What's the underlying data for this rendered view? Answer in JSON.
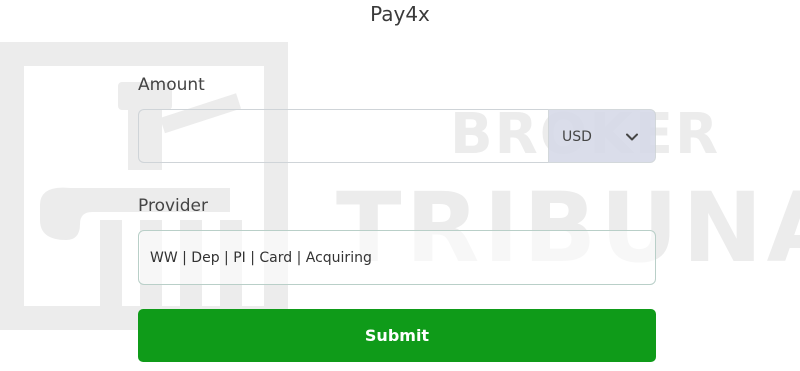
{
  "header": {
    "title": "Pay4x"
  },
  "form": {
    "amount_label": "Amount",
    "amount_value": "",
    "currency": "USD",
    "provider_label": "Provider",
    "provider_value": "WW | Dep | PI | Card | Acquiring",
    "submit_label": "Submit"
  },
  "watermark": {
    "line1": "BROKER",
    "line2": "TRIBUNAL"
  },
  "colors": {
    "submit_bg": "#0f9b19",
    "currency_bg": "#d6dae8",
    "watermark": "#ececec"
  },
  "icons": {
    "currency_dropdown": "chevron-down-icon",
    "watermark_logo": "courthouse-logo-icon"
  }
}
